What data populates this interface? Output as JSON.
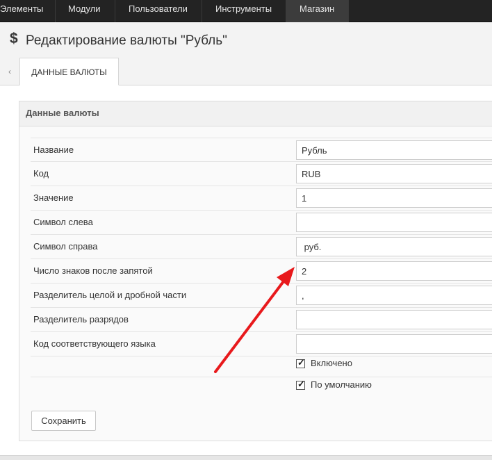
{
  "topnav": {
    "items": [
      {
        "label": "Элементы"
      },
      {
        "label": "Модули"
      },
      {
        "label": "Пользователи"
      },
      {
        "label": "Инструменты"
      },
      {
        "label": "Магазин"
      }
    ],
    "active": "Магазин"
  },
  "header": {
    "icon": "dollar-icon",
    "title": "Редактирование валюты \"Рубль\""
  },
  "tabs": {
    "scroll_left_icon": "chevron-left-icon",
    "active_tab": "ДАННЫЕ ВАЛЮТЫ"
  },
  "panel": {
    "title": "Данные валюты"
  },
  "form": {
    "fields": [
      {
        "label": "Название",
        "value": "Рубль"
      },
      {
        "label": "Код",
        "value": "RUB"
      },
      {
        "label": "Значение",
        "value": "1"
      },
      {
        "label": "Символ слева",
        "value": ""
      },
      {
        "label": "Символ справа",
        "value": " руб."
      },
      {
        "label": "Число знаков после запятой",
        "value": "2"
      },
      {
        "label": "Разделитель целой и дробной части",
        "value": ","
      },
      {
        "label": "Разделитель разрядов",
        "value": ""
      },
      {
        "label": "Код соответствующего языка",
        "value": ""
      }
    ],
    "checkboxes": [
      {
        "label": "Включено",
        "checked": true
      },
      {
        "label": "По умолчанию",
        "checked": true
      }
    ],
    "save_label": "Сохранить"
  },
  "annotation": {
    "arrow_color": "#e8191c"
  },
  "colors": {
    "nav_background": "#232323",
    "nav_active": "#3c3c3c"
  }
}
